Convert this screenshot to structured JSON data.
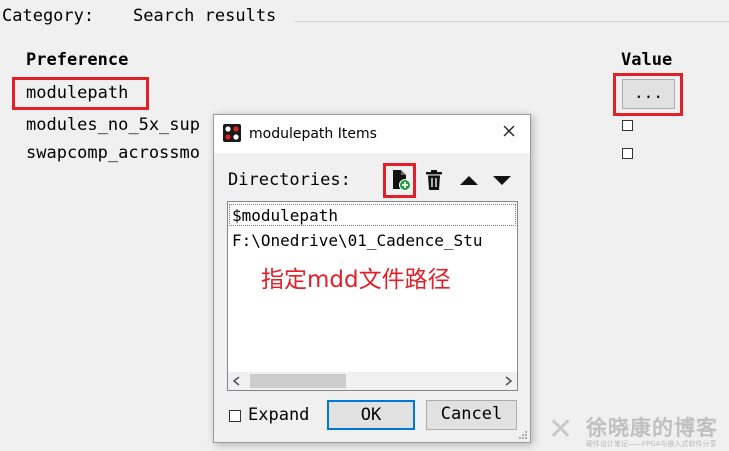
{
  "category": {
    "label": "Category:",
    "value": "Search results"
  },
  "table": {
    "pref_header": "Preference",
    "value_header": "Value",
    "rows": [
      {
        "name": "modulepath",
        "value": "..."
      },
      {
        "name": "modules_no_5x_sup",
        "checked": false
      },
      {
        "name": "swapcomp_acrossmo",
        "checked": false
      }
    ]
  },
  "dialog": {
    "title": "modulepath Items",
    "directories_label": "Directories:",
    "toolbar": [
      "add-file-icon",
      "delete-icon",
      "move-up-icon",
      "move-down-icon"
    ],
    "items": [
      "$modulepath",
      "F:\\Onedrive\\01_Cadence_Stu"
    ],
    "annotation": "指定mdd文件路径",
    "expand_label": "Expand",
    "expand_checked": false,
    "ok_label": "OK",
    "cancel_label": "Cancel"
  },
  "watermark": {
    "title": "徐晓康的博客",
    "subtitle": "硬件设计笔记——FPGA与嵌入式软件分享"
  },
  "colors": {
    "highlight_red": "#e3202a",
    "focus_blue": "#0078d7",
    "add_badge_green": "#1e9e3c"
  }
}
